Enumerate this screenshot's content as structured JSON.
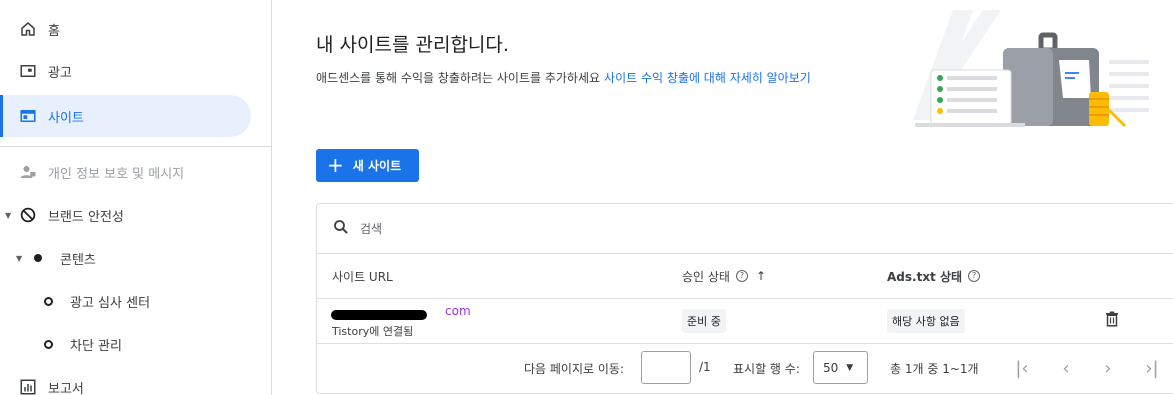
{
  "sidebar": {
    "items": [
      {
        "label": "홈",
        "icon": "home-icon"
      },
      {
        "label": "광고",
        "icon": "ads-icon"
      },
      {
        "label": "사이트",
        "icon": "sites-icon"
      },
      {
        "label": "개인 정보 보호 및 메시지",
        "icon": "person-privacy-icon"
      },
      {
        "label": "브랜드 안전성",
        "icon": "block-icon"
      },
      {
        "label": "콘텐츠",
        "icon": "dot-icon"
      },
      {
        "label": "광고 심사 센터",
        "icon": "ring-icon"
      },
      {
        "label": "차단 관리",
        "icon": "ring-icon"
      },
      {
        "label": "보고서",
        "icon": "bar-chart-icon"
      }
    ]
  },
  "main": {
    "title": "내 사이트를 관리합니다.",
    "subtitle": "애드센스를 통해 수익을 창출하려는 사이트를 추가하세요",
    "learn_more_link": "사이트 수익 창출에 대해 자세히 알아보기",
    "new_site_button": "새 사이트",
    "search_placeholder": "검색"
  },
  "table": {
    "columns": {
      "site_url": "사이트 URL",
      "approval_status": "승인 상태",
      "ads_txt_status": "Ads.txt 상태"
    },
    "rows": [
      {
        "url_suffix": "com",
        "connected": "Tistory에 연결됨",
        "approval": "준비 중",
        "ads_txt": "해당 사항 없음"
      }
    ]
  },
  "pagination": {
    "goto_label": "다음 페이지로 이동:",
    "page_total": "/1",
    "rows_label": "표시할 행 수:",
    "rows_value": "50",
    "summary": "총 1개 중 1~1개"
  },
  "colors": {
    "accent": "#1a73e8",
    "active_bg": "#e8f0fe"
  }
}
